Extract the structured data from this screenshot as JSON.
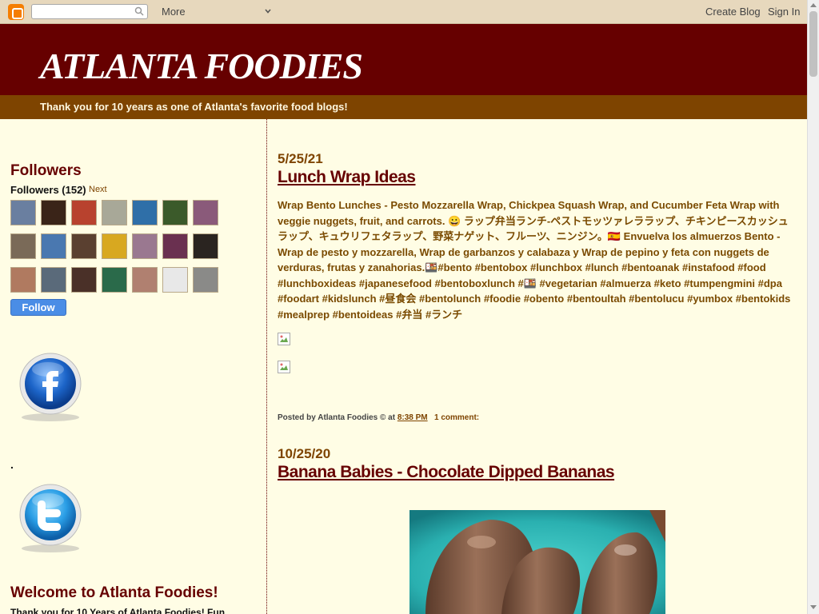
{
  "navbar": {
    "more_label": "More",
    "create_blog_label": "Create Blog",
    "sign_in_label": "Sign In",
    "search": {
      "value": "",
      "placeholder": ""
    }
  },
  "header": {
    "title": "ATLANTA FOODIES",
    "description": "Thank you for 10 years as one of Atlanta's favorite food blogs!"
  },
  "sidebar": {
    "followers_title": "Followers",
    "followers_count": "Followers (152)",
    "next_label": "Next",
    "follow_button": "Follow",
    "avatar_colors": [
      "#6a7fa0",
      "#3a2418",
      "#b8422e",
      "#a8a898",
      "#2f6fa8",
      "#3b5a2a",
      "#8a5a7a",
      "#7a6a58",
      "#4a78b0",
      "#5a4030",
      "#d8a820",
      "#9a7890",
      "#6a3050",
      "#2a2420",
      "#b07a60",
      "#5a6a7a",
      "#4a3028",
      "#2a6a4a",
      "#b08070",
      "#e8e8e8",
      "#8a8a88"
    ],
    "facebook_icon": "facebook-icon",
    "dot_text": ".",
    "twitter_icon": "twitter-icon",
    "welcome_title": "Welcome to Atlanta Foodies!",
    "welcome_text": "Thank you for 10 Years of Atlanta Foodies! Fun"
  },
  "posts": [
    {
      "date": "5/25/21",
      "title": "Lunch Wrap Ideas",
      "body": "Wrap Bento Lunches - Pesto Mozzarella Wrap, Chickpea Squash Wrap, and Cucumber Feta Wrap with veggie nuggets, fruit, and carrots. 😀 ラップ弁当ランチ-ペストモッツァレララップ、チキンピースカッシュラップ、キュウリフェタラップ、野菜ナゲット、フルーツ、ニンジン。🇪🇸 Envuelva los almuerzos Bento - Wrap de pesto y mozzarella, Wrap de garbanzos y calabaza y Wrap de pepino y feta con nuggets de verduras, frutas y zanahorias.🍱#bento #bentobox #lunchbox #lunch #bentoanak #instafood #food #lunchboxideas #japanesefood #bentoboxlunch #🍱 #vegetarian #almuerza #keto #tumpengmini #dpa #foodart #kidslunch #昼食会 #bentolunch #foodie #obento #bentoultah #bentolucu #yumbox #bentokids #mealprep #bentoideas #弁当 #ランチ",
      "posted_by_prefix": "Posted by",
      "author": "Atlanta Foodies ©",
      "at_label": "at",
      "time": "8:38 PM",
      "comments": "1 comment:"
    },
    {
      "date": "10/25/20",
      "title": "Banana Babies - Chocolate Dipped Bananas"
    }
  ]
}
